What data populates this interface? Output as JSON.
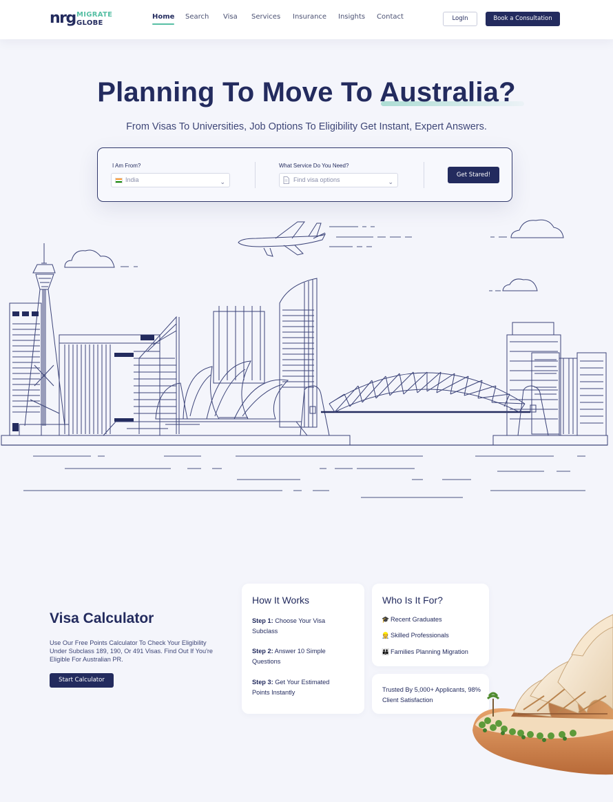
{
  "brand": {
    "mark": "nrg",
    "line1": "MIGRATE",
    "line2": "GLOBE"
  },
  "nav": [
    "Home",
    "Search",
    "Visa",
    "Services",
    "Insurance",
    "Insights",
    "Contact"
  ],
  "header": {
    "login": "LogIn",
    "consult": "Book a Consultation"
  },
  "hero": {
    "title_plain": "Planning To Move To ",
    "title_bold": "Australia?",
    "subtitle": "From Visas To Universities, Job Options To Eligibility Get Instant, Expert Answers."
  },
  "search": {
    "from_label": "I Am From?",
    "from_value": "India",
    "service_label": "What Service Do You Need?",
    "service_placeholder": "Find visa options",
    "button": "Get Stared!"
  },
  "calculator": {
    "title": "Visa Calculator",
    "desc": "Use Our Free Points Calculator To Check Your Eligibility Under Subclass 189, 190, Or 491 Visas. Find Out If You're Eligible For Australian PR.",
    "button": "Start Calculator"
  },
  "how": {
    "title": "How It Works",
    "steps": [
      {
        "label": "Step 1:",
        "text": " Choose Your Visa Subclass"
      },
      {
        "label": "Step 2:",
        "text": " Answer 10 Simple Questions"
      },
      {
        "label": "Step 3:",
        "text": " Get Your Estimated Points Instantly"
      }
    ]
  },
  "who": {
    "title": "Who Is It For?",
    "items": [
      {
        "icon": "graduate-icon",
        "text": "Recent Graduates"
      },
      {
        "icon": "professional-icon",
        "text": "Skilled Professionals"
      },
      {
        "icon": "family-icon",
        "text": "Families Planning Migration"
      }
    ]
  },
  "trust": "Trusted By 5,000+ Applicants, 98% Client Satisfaction",
  "colors": {
    "navy": "#232b5e",
    "accent": "#56bfa4",
    "bg": "#f4f5fb"
  }
}
